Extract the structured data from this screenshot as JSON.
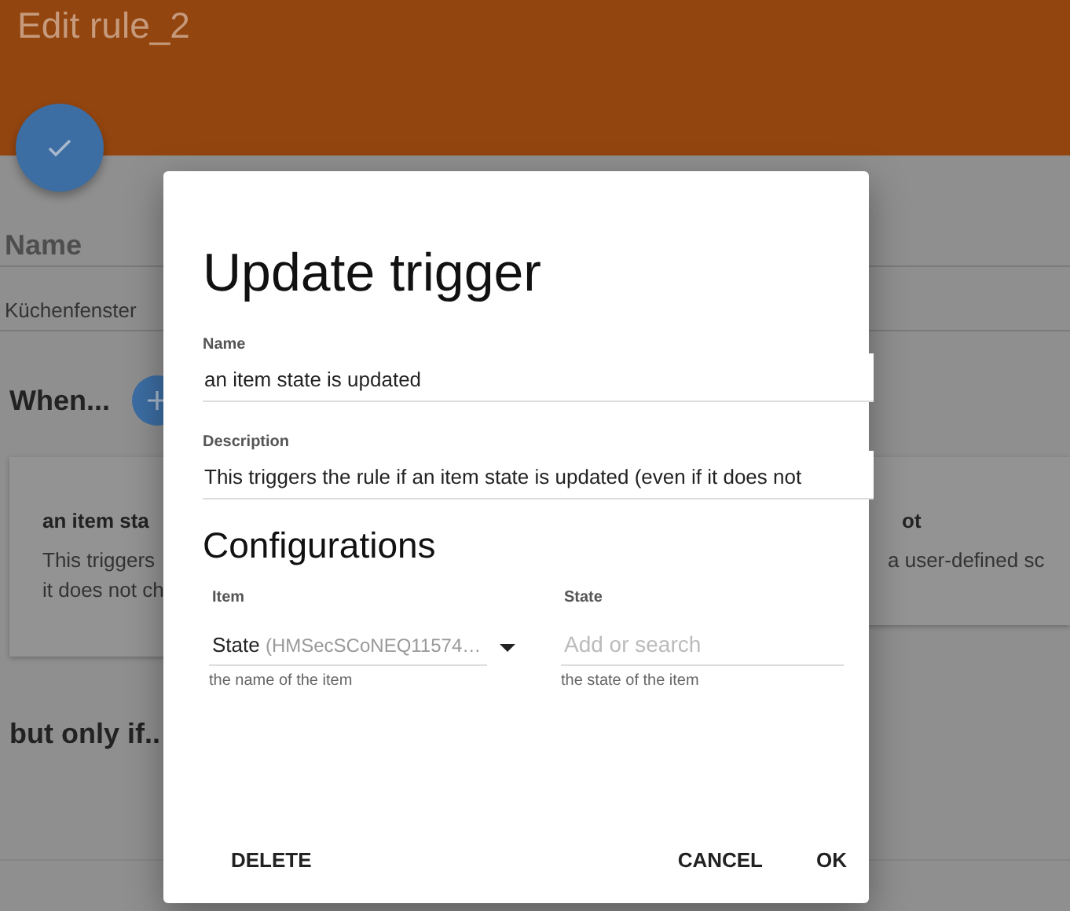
{
  "page": {
    "title": "Edit rule_2",
    "name_label": "Name",
    "name_value": "Küchenfenster",
    "when_heading": "When...",
    "trigger_cards": [
      {
        "title": "an item sta",
        "description_lines": [
          "This triggers",
          "it does not ch"
        ]
      },
      {
        "title": "ot",
        "description_lines": [
          "a user-defined sc"
        ]
      }
    ],
    "condition_heading": "but only if.."
  },
  "dialog": {
    "title": "Update trigger",
    "fields": [
      {
        "label": "Name",
        "value": "an item state is updated"
      },
      {
        "label": "Description",
        "value": "This triggers the rule if an item state is updated (even if it does not"
      }
    ],
    "section": "Configurations",
    "config": [
      {
        "kind": "select",
        "label": "Item",
        "value": "State",
        "value_detail": "(HMSecSCoNEQ11574…",
        "hint": "the name of the item"
      },
      {
        "kind": "input",
        "label": "State",
        "placeholder": "Add or search",
        "hint": "the state of the item"
      }
    ],
    "start_buttons": [
      "DELETE"
    ],
    "end_buttons": [
      "CANCEL",
      "OK"
    ]
  }
}
